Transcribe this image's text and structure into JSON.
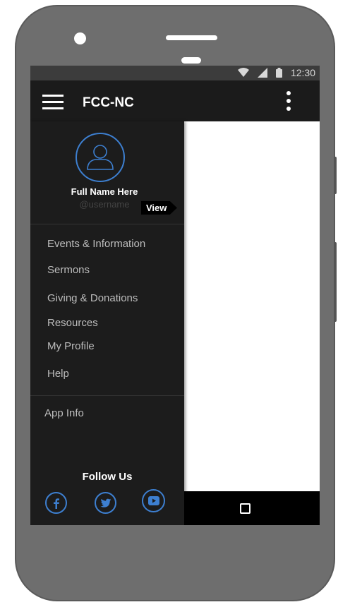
{
  "status_bar": {
    "time": "12:30"
  },
  "app_bar": {
    "title": "FCC-NC"
  },
  "drawer": {
    "profile": {
      "full_name": "Full Name Here",
      "username": "@username",
      "view_label": "View"
    },
    "menu": [
      {
        "label": "Events & Information"
      },
      {
        "label": "Sermons"
      },
      {
        "label": "Giving & Donations"
      },
      {
        "label": "Resources"
      },
      {
        "label": "My Profile"
      },
      {
        "label": "Help"
      }
    ],
    "app_info": "App Info",
    "follow_us": "Follow Us",
    "social": [
      "facebook-icon",
      "twitter-icon",
      "youtube-icon"
    ]
  },
  "colors": {
    "accent": "#3d7fd0",
    "drawer_bg": "#1c1c1c",
    "appbar_bg": "#1b1b1b"
  }
}
